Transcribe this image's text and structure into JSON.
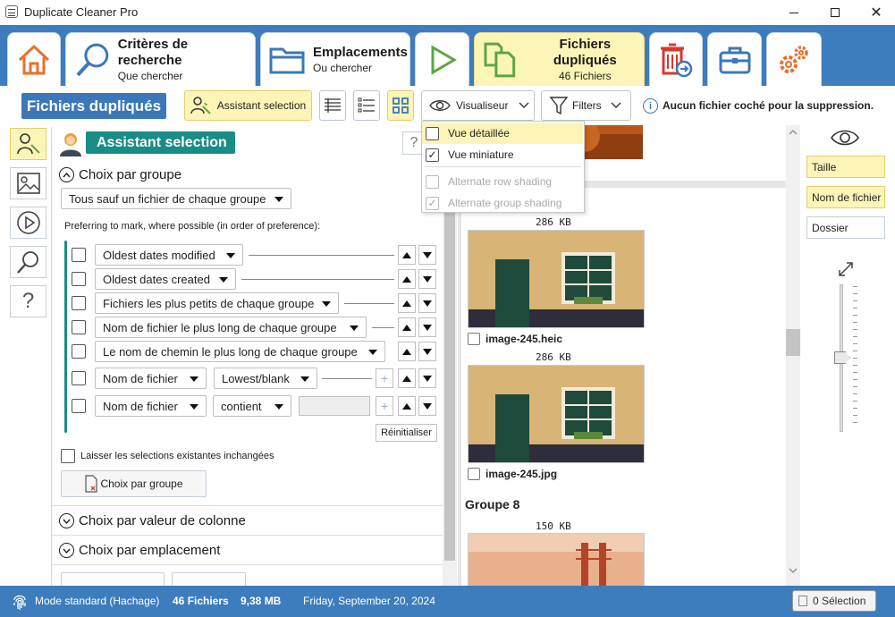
{
  "window": {
    "title": "Duplicate Cleaner Pro"
  },
  "tabs": [
    {
      "title": "Critères de recherche",
      "subtitle": "Que chercher"
    },
    {
      "title": "Emplacements",
      "subtitle": "Ou chercher"
    },
    {
      "title": "Fichiers dupliqués",
      "subtitle": "46 Fichiers"
    }
  ],
  "toolbar": {
    "title": "Fichiers dupliqués",
    "assistant": "Assistant selection",
    "viewer": "Visualiseur",
    "filters": "Filters",
    "notice": "Aucun fichier coché pour la suppression."
  },
  "viewer_menu": {
    "items": [
      {
        "label": "Vue détaillée",
        "checked": false,
        "disabled": false
      },
      {
        "label": "Vue miniature",
        "checked": true,
        "disabled": false
      },
      {
        "label": "Alternate row shading",
        "checked": false,
        "disabled": true
      },
      {
        "label": "Alternate group shading",
        "checked": true,
        "disabled": true
      }
    ]
  },
  "assistant": {
    "header": "Assistant selection",
    "help": "?",
    "group_section": "Choix par groupe",
    "group_mode": "Tous sauf un fichier de chaque groupe",
    "preference_label": "Preferring to mark, where possible (in order of preference):",
    "rules": [
      {
        "label": "Oldest dates modified"
      },
      {
        "label": "Oldest dates created"
      },
      {
        "label": "Fichiers les plus petits de chaque groupe"
      },
      {
        "label": "Nom de fichier le plus long de chaque groupe"
      },
      {
        "label": "Le nom de chemin le plus long de chaque groupe"
      },
      {
        "label": "Nom de fichier",
        "option": "Lowest/blank"
      },
      {
        "label": "Nom de fichier",
        "option": "contient"
      }
    ],
    "reset": "Réinitialiser",
    "keep_existing": "Laisser les selections existantes inchangées",
    "apply_button": "Choix par groupe",
    "column_section": "Choix par valeur de colonne",
    "location_section": "Choix par emplacement"
  },
  "results": {
    "items": [
      {
        "size": "286 KB",
        "name": "image-245.heic"
      },
      {
        "size": "286 KB",
        "name": "image-245.jpg"
      }
    ],
    "group8": {
      "title": "Groupe 8",
      "size": "150 KB"
    }
  },
  "side_chips": [
    "Taille",
    "Nom de fichier",
    "Dossier"
  ],
  "status": {
    "mode": "Mode standard (Hachage)",
    "files": "46 Fichiers",
    "size": "9,38 MB",
    "date": "Friday, September 20, 2024",
    "selection": "0 Sélection"
  },
  "colors": {
    "accent": "#3d7dbd",
    "teal": "#1a8c86",
    "yellow": "#fdf5b8",
    "title_blue": "#3b78b7"
  }
}
